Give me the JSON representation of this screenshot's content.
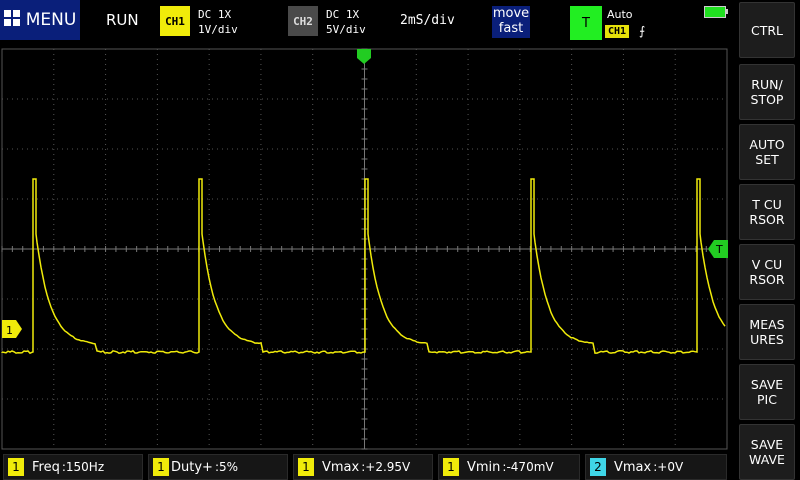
{
  "top_bar": {
    "menu_label": "MENU",
    "run_status": "RUN",
    "ch1": {
      "badge": "CH1",
      "coupling": "DC  1X",
      "scale": "1V/div",
      "color": "#f0eb0a"
    },
    "ch2": {
      "badge": "CH2",
      "coupling": "DC  1X",
      "scale": "5V/div",
      "color": "#4a4a4a"
    },
    "timebase": "2mS/div",
    "move_mode": {
      "line1": "move",
      "line2": "fast"
    },
    "trigger": {
      "badge": "T",
      "mode": "Auto",
      "source": "CH1",
      "edge": "⨍"
    }
  },
  "side_buttons": [
    {
      "label": "CTRL"
    },
    {
      "label": "RUN/\nSTOP"
    },
    {
      "label": "AUTO\nSET"
    },
    {
      "label": "T CU\nRSOR"
    },
    {
      "label": "V CU\nRSOR"
    },
    {
      "label": "MEAS\nURES"
    },
    {
      "label": "SAVE\nPIC"
    },
    {
      "label": "SAVE\nWAVE"
    }
  ],
  "measurements": [
    {
      "channel": "1",
      "label": "Freq",
      "value": ":150Hz",
      "color": "#f0eb0a"
    },
    {
      "channel": "1",
      "label": "Duty+",
      "value": ":5%",
      "color": "#f0eb0a"
    },
    {
      "channel": "1",
      "label": "Vmax",
      "value": ":+2.95V",
      "color": "#f0eb0a"
    },
    {
      "channel": "1",
      "label": "Vmin",
      "value": ":-470mV",
      "color": "#f0eb0a"
    },
    {
      "channel": "2",
      "label": "Vmax",
      "value": ":+0V",
      "color": "#3fd6e8"
    }
  ],
  "markers": {
    "ch1_marker": "1",
    "trigger_level_marker": "T"
  },
  "colors": {
    "trace": "#f0eb0a",
    "trigger": "#22ee22",
    "accent": "#0a1f7a"
  }
}
